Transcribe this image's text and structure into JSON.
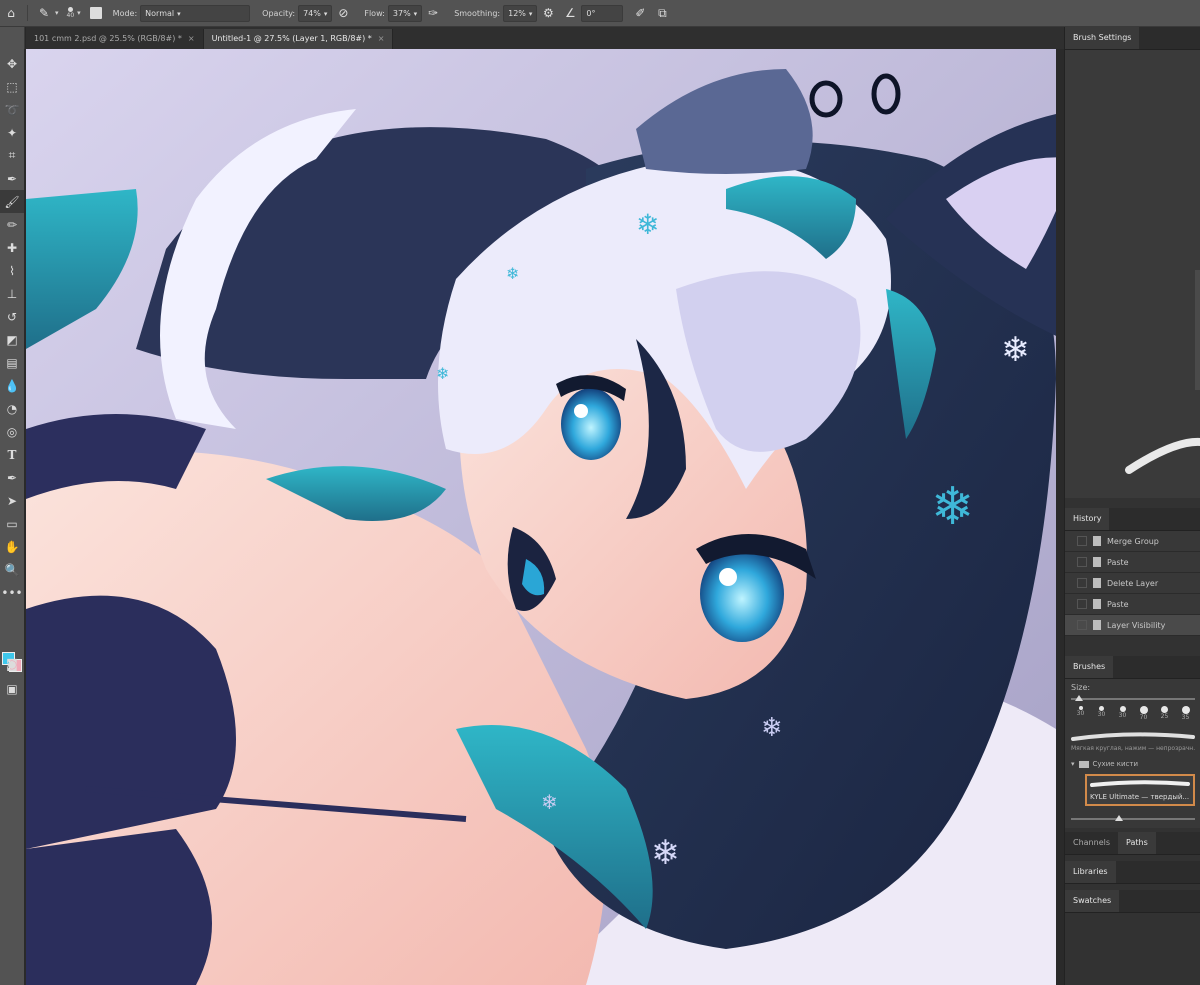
{
  "options_bar": {
    "brush_size": "40",
    "mode_label": "Mode:",
    "mode_value": "Normal",
    "opacity_label": "Opacity:",
    "opacity_value": "74%",
    "flow_label": "Flow:",
    "flow_value": "37%",
    "smoothing_label": "Smoothing:",
    "smoothing_value": "12%",
    "angle_value": "0°"
  },
  "tabs": [
    {
      "label": "101 cmm 2.psd @ 25.5% (RGB/8#) *"
    },
    {
      "label": "Untitled-1 @ 27.5% (Layer 1, RGB/8#) *"
    }
  ],
  "colors": {
    "foreground": "#3ec8ec",
    "background": "#f0a8b8",
    "accent": "#d28a4a"
  },
  "panels": {
    "brush_settings": {
      "title": "Brush Settings"
    },
    "history": {
      "title": "History",
      "items": [
        {
          "label": "Merge Group"
        },
        {
          "label": "Paste"
        },
        {
          "label": "Delete Layer"
        },
        {
          "label": "Paste"
        },
        {
          "label": "Layer Visibility"
        }
      ]
    },
    "brushes": {
      "title": "Brushes",
      "size_label": "Size:",
      "tip_sizes": [
        "30",
        "30",
        "30",
        "70",
        "25",
        "35"
      ],
      "preset_name": "Мягкая круглая, нажим — непрозрачн...",
      "group_name": "Сухие кисти",
      "selected_brush": "KYLE Ultimate — твердый..."
    },
    "channels": {
      "label": "Channels"
    },
    "paths": {
      "label": "Paths"
    },
    "libraries": {
      "title": "Libraries"
    },
    "swatches": {
      "title": "Swatches"
    }
  }
}
